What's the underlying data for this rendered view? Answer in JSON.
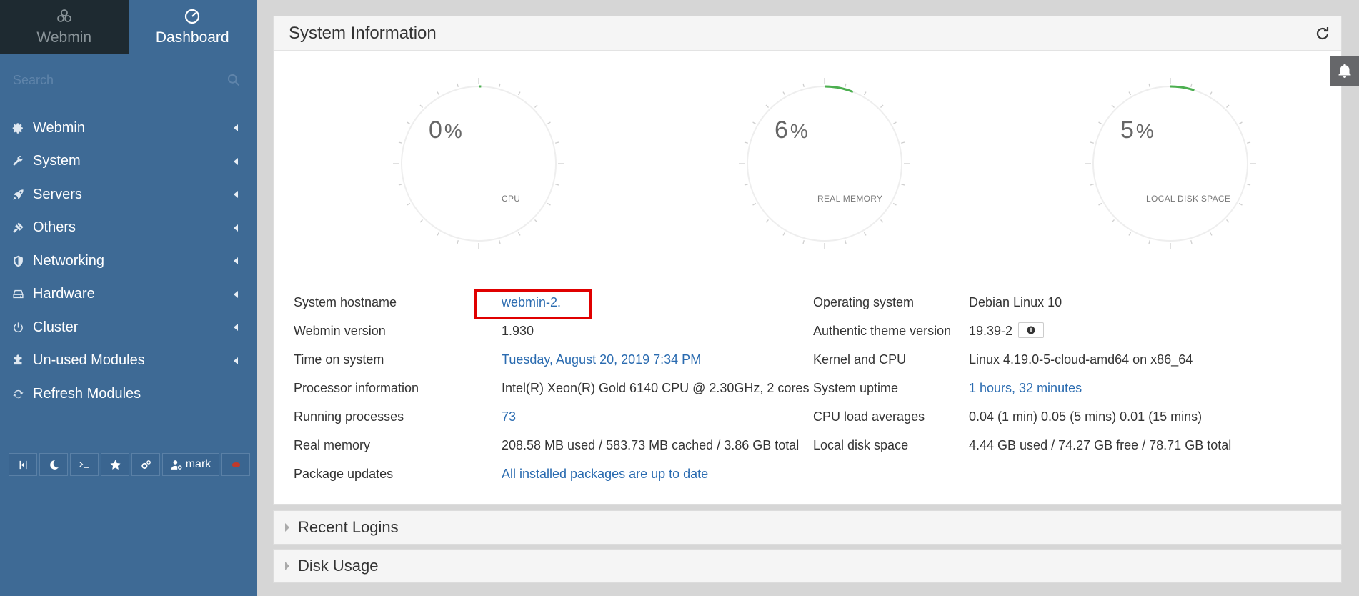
{
  "sidebar": {
    "switch": {
      "webmin_label": "Webmin",
      "dashboard_label": "Dashboard"
    },
    "search_placeholder": "Search",
    "items": [
      {
        "label": "Webmin",
        "icon": "gear-icon"
      },
      {
        "label": "System",
        "icon": "wrench-icon"
      },
      {
        "label": "Servers",
        "icon": "rocket-icon"
      },
      {
        "label": "Others",
        "icon": "gavel-icon"
      },
      {
        "label": "Networking",
        "icon": "shield-icon"
      },
      {
        "label": "Hardware",
        "icon": "hdd-icon"
      },
      {
        "label": "Cluster",
        "icon": "power-icon"
      },
      {
        "label": "Un-used Modules",
        "icon": "puzzle-icon"
      },
      {
        "label": "Refresh Modules",
        "icon": "refresh-icon"
      }
    ],
    "user_label": "mark"
  },
  "system_info": {
    "title": "System Information",
    "gauges": [
      {
        "value": 0,
        "sign": "%",
        "label": "CPU"
      },
      {
        "value": 6,
        "sign": "%",
        "label": "REAL MEMORY"
      },
      {
        "value": 5,
        "sign": "%",
        "label": "LOCAL DISK SPACE"
      }
    ],
    "left_rows": [
      {
        "label": "System hostname",
        "value": "webmin-2.",
        "link": true
      },
      {
        "label": "Webmin version",
        "value": "1.930",
        "link": false
      },
      {
        "label": "Time on system",
        "value": "Tuesday, August 20, 2019 7:34 PM",
        "link": true
      },
      {
        "label": "Processor information",
        "value": "Intel(R) Xeon(R) Gold 6140 CPU @ 2.30GHz, 2 cores",
        "link": false
      },
      {
        "label": "Running processes",
        "value": "73",
        "link": true
      },
      {
        "label": "Real memory",
        "value": "208.58 MB used / 583.73 MB cached / 3.86 GB total",
        "link": false
      },
      {
        "label": "Package updates",
        "value": "All installed packages are up to date",
        "link": true
      }
    ],
    "right_rows": [
      {
        "label": "Operating system",
        "value": "Debian Linux 10",
        "link": false
      },
      {
        "label": "Authentic theme version",
        "value": "19.39-2",
        "link": false
      },
      {
        "label": "Kernel and CPU",
        "value": "Linux 4.19.0-5-cloud-amd64 on x86_64",
        "link": false
      },
      {
        "label": "System uptime",
        "value": "1 hours, 32 minutes",
        "link": true
      },
      {
        "label": "CPU load averages",
        "value": "0.04 (1 min) 0.05 (5 mins) 0.01 (15 mins)",
        "link": false
      },
      {
        "label": "Local disk space",
        "value": "4.44 GB used / 74.27 GB free / 78.71 GB total",
        "link": false
      }
    ]
  },
  "panels": {
    "recent_logins": "Recent Logins",
    "disk_usage": "Disk Usage"
  },
  "colors": {
    "sidebar": "#3e6a95",
    "accent_green": "#4caf50",
    "link": "#2a6bb0",
    "highlight": "#e00000"
  }
}
